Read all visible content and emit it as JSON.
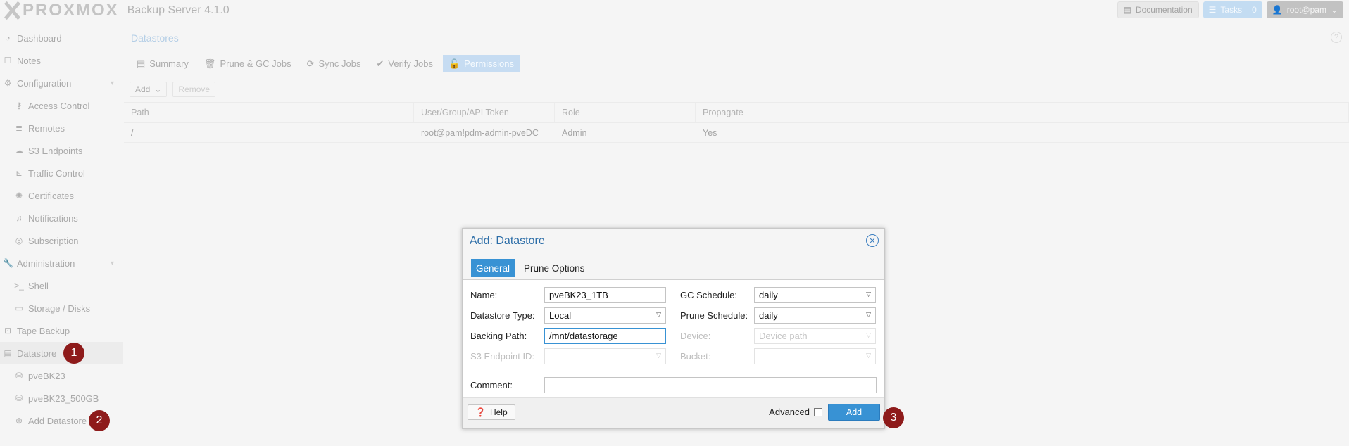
{
  "topbar": {
    "logo_text": "PROXMOX",
    "product": "Backup Server 4.1.0",
    "documentation": "Documentation",
    "tasks_label": "Tasks",
    "tasks_count": "0",
    "user": "root@pam"
  },
  "sidebar": {
    "items": [
      {
        "label": "Dashboard",
        "icon": "dashboard-icon"
      },
      {
        "label": "Notes",
        "icon": "note-icon"
      },
      {
        "label": "Configuration",
        "icon": "gears-icon"
      },
      {
        "label": "Access Control",
        "icon": "key-icon"
      },
      {
        "label": "Remotes",
        "icon": "server-icon"
      },
      {
        "label": "S3 Endpoints",
        "icon": "cloud-icon"
      },
      {
        "label": "Traffic Control",
        "icon": "chart-icon"
      },
      {
        "label": "Certificates",
        "icon": "certificate-icon"
      },
      {
        "label": "Notifications",
        "icon": "bell-icon"
      },
      {
        "label": "Subscription",
        "icon": "support-icon"
      },
      {
        "label": "Administration",
        "icon": "wrench-icon"
      },
      {
        "label": "Shell",
        "icon": "terminal-icon"
      },
      {
        "label": "Storage / Disks",
        "icon": "hdd-icon"
      },
      {
        "label": "Tape Backup",
        "icon": "tape-icon"
      },
      {
        "label": "Datastore",
        "icon": "archive-icon"
      },
      {
        "label": "pveBK23",
        "icon": "database-icon"
      },
      {
        "label": "pveBK23_500GB",
        "icon": "database-icon"
      },
      {
        "label": "Add Datastore",
        "icon": "plus-circle-icon"
      }
    ],
    "badges": [
      "1",
      "2"
    ]
  },
  "main": {
    "title": "Datastores",
    "help": "?",
    "tabs": [
      "Summary",
      "Prune & GC Jobs",
      "Sync Jobs",
      "Verify Jobs",
      "Permissions"
    ],
    "toolbar": {
      "add": "Add",
      "remove": "Remove"
    },
    "grid": {
      "columns": [
        "Path",
        "User/Group/API Token",
        "Role",
        "Propagate"
      ],
      "rows": [
        [
          "/",
          "root@pam!pdm-admin-pveDC",
          "Admin",
          "Yes"
        ]
      ]
    }
  },
  "dialog": {
    "title": "Add: Datastore",
    "tabs": [
      "General",
      "Prune Options"
    ],
    "fields": {
      "name_label": "Name:",
      "name_value": "pveBK23_1TB",
      "type_label": "Datastore Type:",
      "type_value": "Local",
      "path_label": "Backing Path:",
      "path_value": "/mnt/datastorage",
      "s3_label": "S3 Endpoint ID:",
      "s3_value": "",
      "gc_label": "GC Schedule:",
      "gc_value": "daily",
      "prune_label": "Prune Schedule:",
      "prune_value": "daily",
      "device_label": "Device:",
      "device_placeholder": "Device path",
      "bucket_label": "Bucket:",
      "bucket_value": "",
      "comment_label": "Comment:",
      "comment_value": ""
    },
    "footer": {
      "help": "Help",
      "advanced": "Advanced",
      "add": "Add",
      "badge": "3"
    }
  }
}
